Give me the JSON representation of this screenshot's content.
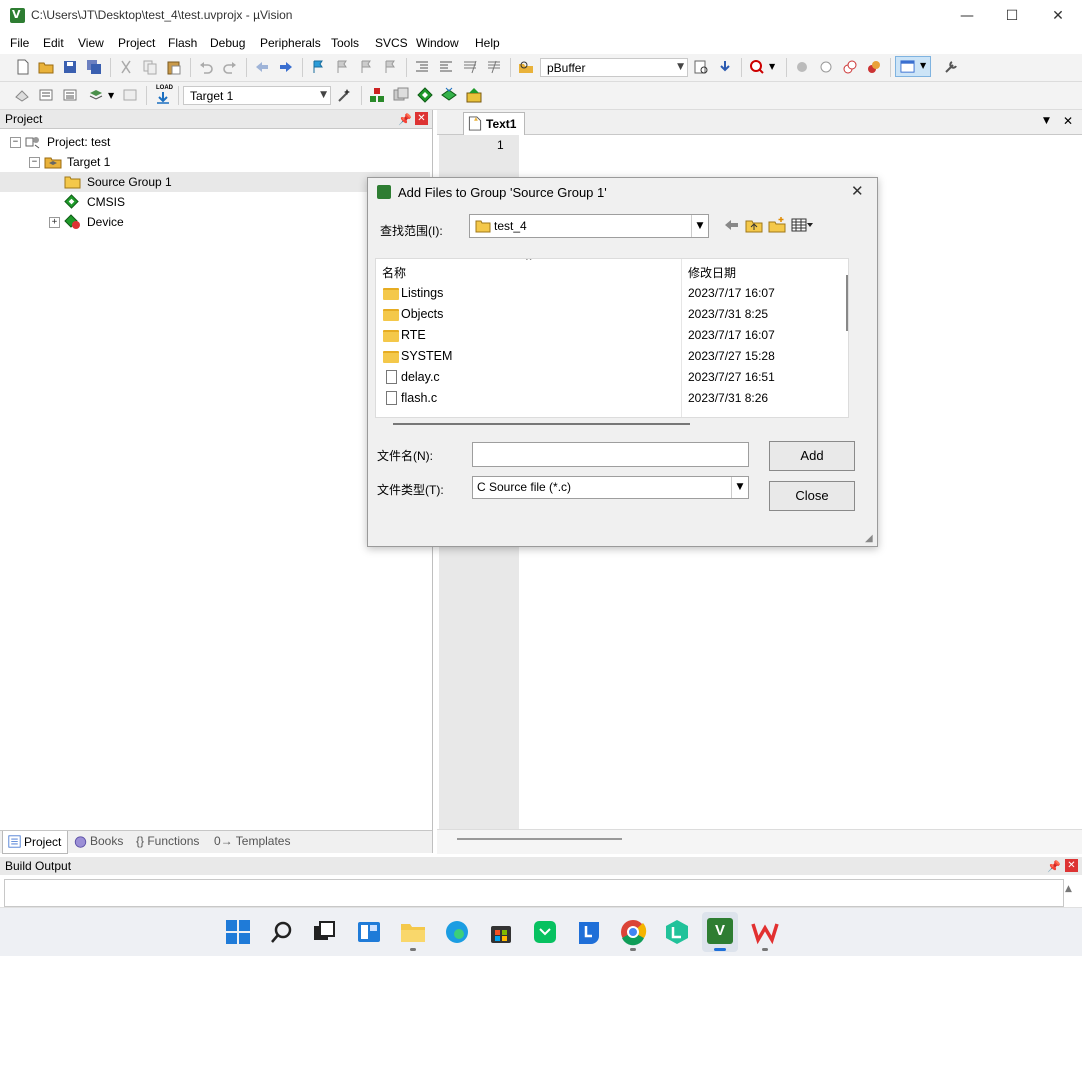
{
  "window": {
    "title": "C:\\Users\\JT\\Desktop\\test_4\\test.uvprojx - µVision",
    "minimize": "—",
    "maximize": "☐",
    "close": "✕"
  },
  "menu": [
    "File",
    "Edit",
    "View",
    "Project",
    "Flash",
    "Debug",
    "Peripherals",
    "Tools",
    "SVCS",
    "Window",
    "Help"
  ],
  "toolbar1": {
    "find_combo_value": "pBuffer"
  },
  "toolbar2": {
    "load_label": "LOAD",
    "target_combo_value": "Target 1"
  },
  "project_panel": {
    "title": "Project",
    "tree": {
      "root": "Project: test",
      "target": "Target 1",
      "group": "Source Group 1",
      "cmsis": "CMSIS",
      "device": "Device"
    },
    "bottom_tabs": [
      "Project",
      "Books",
      "{} Functions",
      "0→ Templates"
    ]
  },
  "editor": {
    "tab": "Text1",
    "line_number": "1"
  },
  "build_output": {
    "title": "Build Output"
  },
  "dialog": {
    "title": "Add Files to Group 'Source Group 1'",
    "look_in_label": "查找范围(I):",
    "look_in_value": "test_4",
    "columns": {
      "name": "名称",
      "modified": "修改日期"
    },
    "files": [
      {
        "name": "Listings",
        "date": "2023/7/17 16:07",
        "kind": "folder"
      },
      {
        "name": "Objects",
        "date": "2023/7/31 8:25",
        "kind": "folder"
      },
      {
        "name": "RTE",
        "date": "2023/7/17 16:07",
        "kind": "folder"
      },
      {
        "name": "SYSTEM",
        "date": "2023/7/27 15:28",
        "kind": "folder"
      },
      {
        "name": "delay.c",
        "date": "2023/7/27 16:51",
        "kind": "file"
      },
      {
        "name": "flash.c",
        "date": "2023/7/31 8:26",
        "kind": "file"
      }
    ],
    "filename_label": "文件名(N):",
    "filename_value": "",
    "filetype_label": "文件类型(T):",
    "filetype_value": "C Source file (*.c)",
    "add_button": "Add",
    "close_button": "Close"
  },
  "colors": {
    "accent": "#2e7d32",
    "selection": "#cce4f7",
    "folder": "#f4c84a"
  },
  "taskbar": {
    "apps": [
      "windows-start",
      "search",
      "task-view",
      "widgets",
      "file-explorer",
      "edge",
      "store",
      "wechat",
      "lenovo",
      "chrome",
      "dev-tool",
      "uvision",
      "wps"
    ]
  }
}
